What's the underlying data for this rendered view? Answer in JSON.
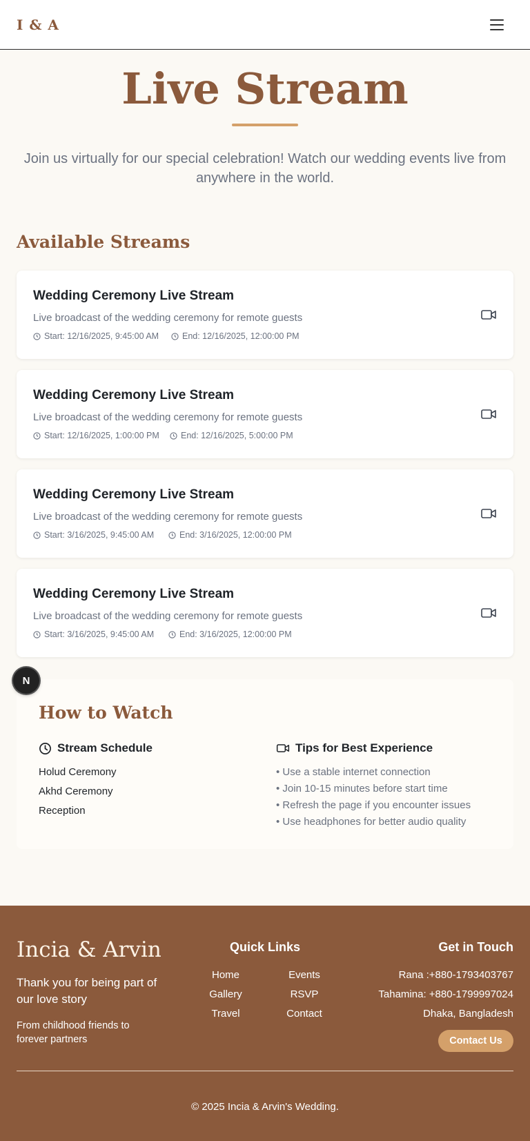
{
  "header": {
    "logo": "I & A",
    "menu_icon": "hamburger-menu-icon"
  },
  "hero": {
    "title": "Live Stream",
    "subtitle": "Join us virtually for our special celebration! Watch our wedding events live from anywhere in the world."
  },
  "streams_section": {
    "title": "Available Streams"
  },
  "streams": [
    {
      "title": "Wedding Ceremony Live Stream",
      "description": "Live broadcast of the wedding ceremony for remote guests",
      "start": "Start: 12/16/2025, 9:45:00 AM",
      "end": "End: 12/16/2025, 12:00:00 PM"
    },
    {
      "title": "Wedding Ceremony Live Stream",
      "description": "Live broadcast of the wedding ceremony for remote guests",
      "start": "Start: 12/16/2025, 1:00:00 PM",
      "end": "End: 12/16/2025, 5:00:00 PM"
    },
    {
      "title": "Wedding Ceremony Live Stream",
      "description": "Live broadcast of the wedding ceremony for remote guests",
      "start": "Start: 3/16/2025, 9:45:00 AM",
      "end": "End: 3/16/2025, 12:00:00 PM"
    },
    {
      "title": "Wedding Ceremony Live Stream",
      "description": "Live broadcast of the wedding ceremony for remote guests",
      "start": "Start: 3/16/2025, 9:45:00 AM",
      "end": "End: 3/16/2025, 12:00:00 PM"
    }
  ],
  "fab": {
    "label": "N"
  },
  "how_to_watch": {
    "title": "How to Watch",
    "schedule_title": "Stream Schedule",
    "schedule": [
      "Holud Ceremony",
      "Akhd Ceremony",
      "Reception"
    ],
    "tips_title": "Tips for Best Experience",
    "tips": [
      "• Use a stable internet connection",
      "• Join 10-15 minutes before start time",
      "• Refresh the page if you encounter issues",
      "• Use headphones for better audio quality"
    ]
  },
  "footer": {
    "brand": "Incia & Arvin",
    "tagline": "Thank you for being part of our love story",
    "subtag": "From childhood friends to forever partners",
    "quick_links_title": "Quick Links",
    "links": [
      "Home",
      "Events",
      "Gallery",
      "RSVP",
      "Travel",
      "Contact"
    ],
    "contact_title": "Get in Touch",
    "contacts": [
      "Rana :+880-1793403767",
      "Tahamina: +880-1799997024",
      "Dhaka, Bangladesh"
    ],
    "contact_button": "Contact Us",
    "copyright": "© 2025 Incia & Arvin's Wedding."
  },
  "colors": {
    "brand": "#8b5a3c",
    "accent": "#d4a06a",
    "background": "#fbf9f4",
    "muted": "#6b7280"
  }
}
